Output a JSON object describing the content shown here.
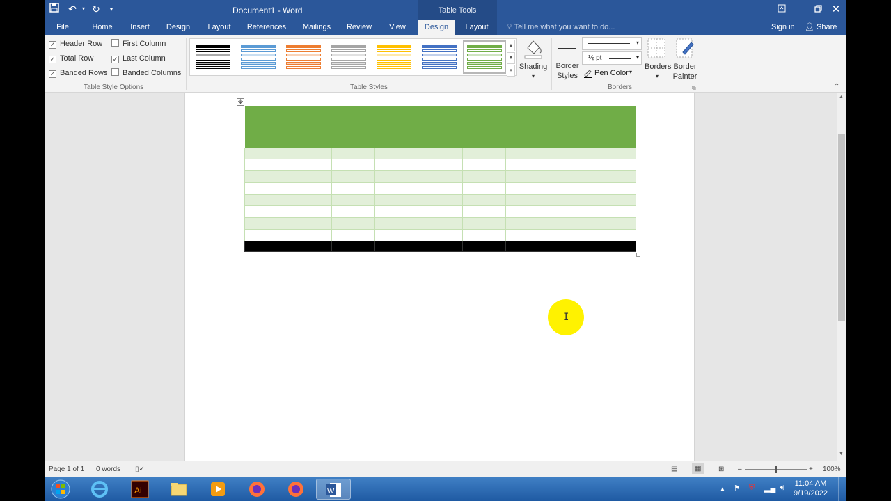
{
  "window": {
    "title": "Document1 - Word",
    "contextual_group": "Table Tools",
    "qat": {
      "save_icon": "save-icon",
      "undo_icon": "undo-icon",
      "redo_icon": "redo-icon",
      "customize": "▾"
    }
  },
  "tabs": [
    {
      "label": "File"
    },
    {
      "label": "Home"
    },
    {
      "label": "Insert"
    },
    {
      "label": "Design"
    },
    {
      "label": "Layout"
    },
    {
      "label": "References"
    },
    {
      "label": "Mailings"
    },
    {
      "label": "Review"
    },
    {
      "label": "View"
    },
    {
      "label": "Design"
    },
    {
      "label": "Layout"
    }
  ],
  "active_tab_index": 9,
  "tell_me": "Tell me what you want to do...",
  "sign_in": "Sign in",
  "share": "Share",
  "ribbon": {
    "table_style_options": {
      "header_row": {
        "label": "Header Row",
        "checked": true
      },
      "first_column": {
        "label": "First Column",
        "checked": false
      },
      "total_row": {
        "label": "Total Row",
        "checked": true
      },
      "last_column": {
        "label": "Last Column",
        "checked": true
      },
      "banded_rows": {
        "label": "Banded Rows",
        "checked": true
      },
      "banded_columns": {
        "label": "Banded Columns",
        "checked": false
      },
      "group_label": "Table Style Options"
    },
    "table_styles": {
      "group_label": "Table Styles",
      "swatch_colors": [
        "#000000",
        "#5b9bd5",
        "#ed7d31",
        "#a5a5a5",
        "#ffc000",
        "#4472c4",
        "#70ad47"
      ],
      "selected_index": 6
    },
    "shading": {
      "label": "Shading"
    },
    "borders_group": {
      "border_styles": "Border Styles",
      "weight": "½ pt",
      "pen_color": "Pen Color",
      "borders": "Borders",
      "border_painter": "Border Painter",
      "group_label": "Borders"
    }
  },
  "document": {
    "table": {
      "columns": 9,
      "body_rows": 8,
      "header_color": "#70ad47",
      "band_color": "#e2efd9",
      "total_row_color": "#000000"
    }
  },
  "statusbar": {
    "page": "Page 1 of 1",
    "words": "0 words",
    "zoom": "100%"
  },
  "taskbar": {
    "time": "11:04 AM",
    "date": "9/19/2022",
    "apps": [
      "start-orb",
      "internet-explorer",
      "illustrator",
      "file-explorer",
      "media-player",
      "firefox",
      "firefox",
      "word"
    ]
  }
}
